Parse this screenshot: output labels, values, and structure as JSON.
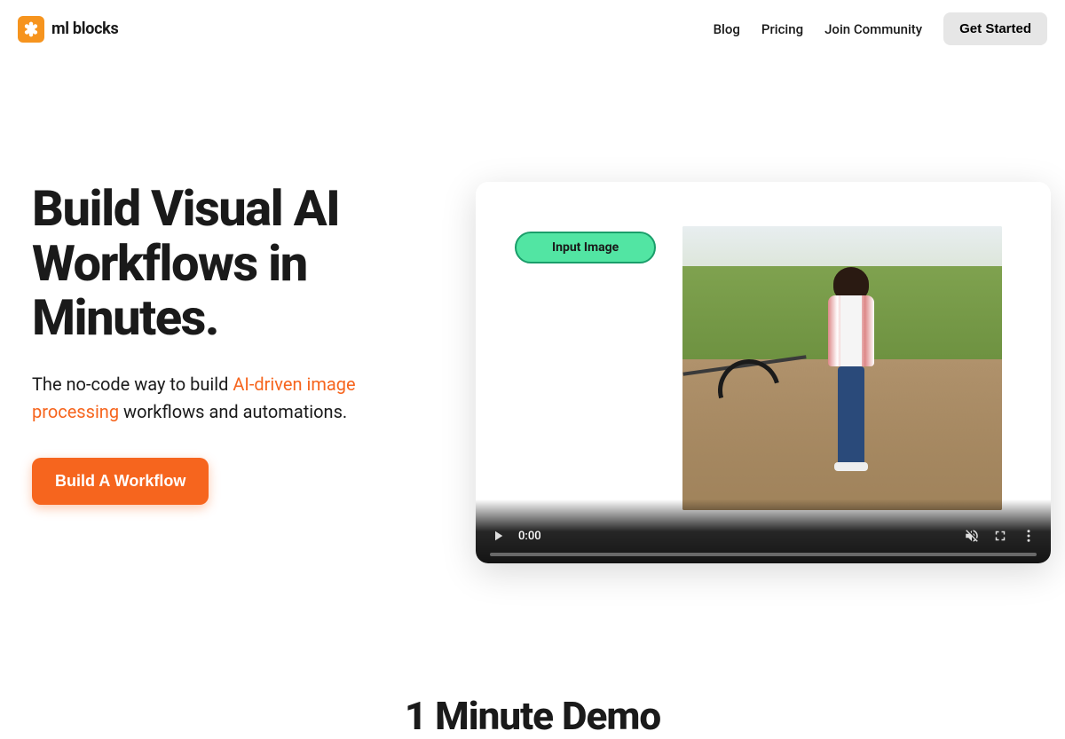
{
  "brand": {
    "name": "ml blocks"
  },
  "nav": {
    "links": [
      "Blog",
      "Pricing",
      "Join Community"
    ],
    "cta": "Get Started"
  },
  "hero": {
    "title": "Build Visual AI Workflows in Minutes.",
    "sub_before": "The no-code way to build ",
    "sub_highlight": "AI-driven image processing",
    "sub_after": " workflows and automations.",
    "button": "Build A Workflow"
  },
  "video": {
    "pill": "Input Image",
    "time": "0:00"
  },
  "section2": {
    "heading": "1 Minute Demo"
  }
}
